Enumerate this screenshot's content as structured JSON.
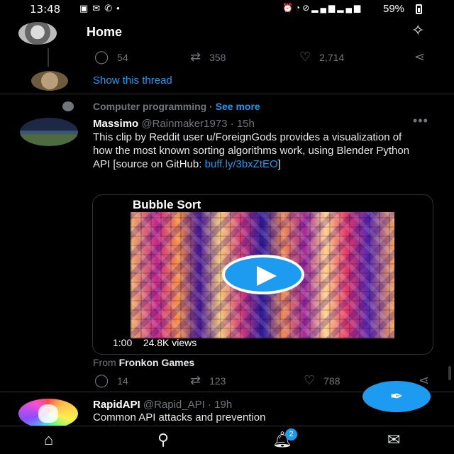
{
  "status_bar": {
    "time": "13:48",
    "battery": "59%",
    "left_icons": [
      "gallery-icon",
      "message-icon",
      "missed-call-icon",
      "dot-icon"
    ],
    "right_icons": [
      "alarm-icon",
      "wifi-icon",
      "mute-icon",
      "signal-icon",
      "signal-icon"
    ]
  },
  "header": {
    "title": "Home"
  },
  "prev_post": {
    "replies": "54",
    "retweets": "358",
    "likes": "2,714",
    "show_thread": "Show this thread"
  },
  "post": {
    "topic": "Computer programming",
    "topic_sep": " · ",
    "see_more": "See more",
    "name": "Massimo",
    "handle": "@Rainmaker1973",
    "time": "15h",
    "text": "This clip by Reddit user u/ForeignGods provides a visualization of how the most known sorting algorithms work, using Blender Python API [source on GitHub:",
    "link": "buff.ly/3bxZtEO",
    "link_suffix": "]",
    "video": {
      "title": "Bubble Sort",
      "duration": "1:00",
      "views": "24.8K views"
    },
    "from_prefix": "From",
    "from_source": "Fronkon Games",
    "replies": "14",
    "retweets": "123",
    "likes": "788"
  },
  "next_post": {
    "name": "RapidAPI",
    "handle": "@Rapid_API",
    "time": "19h",
    "text": "Common API attacks and prevention"
  },
  "bottom_nav": {
    "notifications_badge": "2"
  },
  "colors": {
    "accent": "#1d9bf0",
    "background": "#000000",
    "muted": "#71767b"
  }
}
